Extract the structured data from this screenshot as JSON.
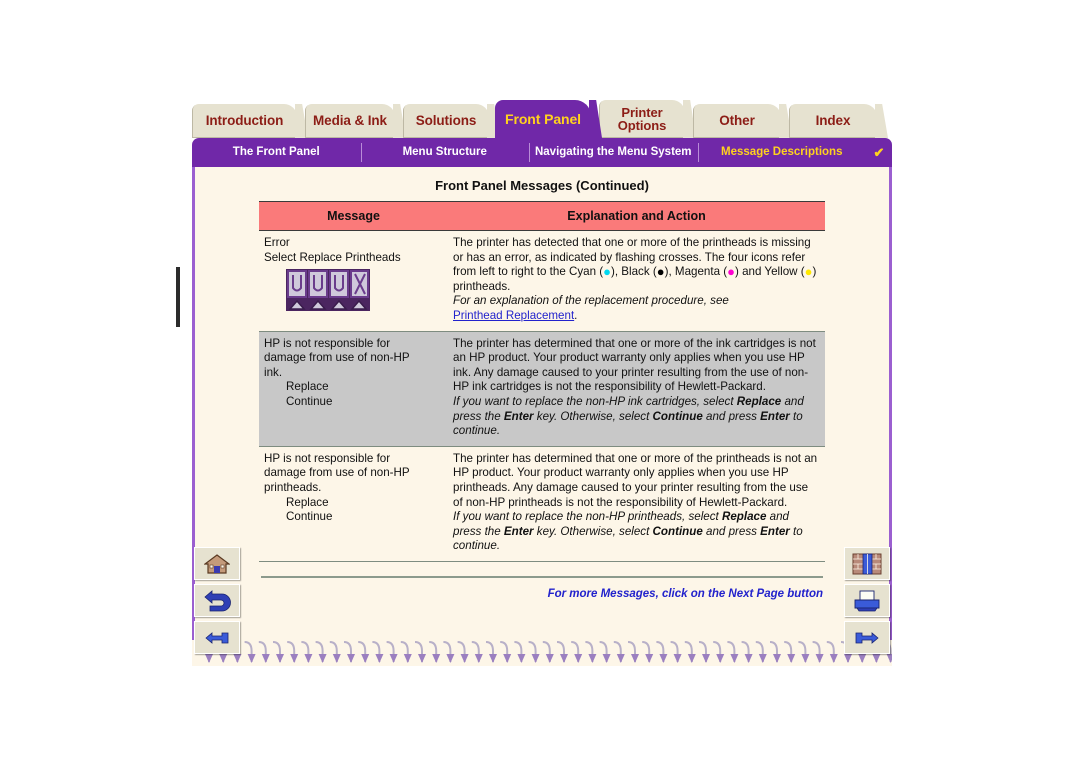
{
  "tabs": [
    {
      "label": "Introduction",
      "active": false
    },
    {
      "label": "Media & Ink",
      "active": false
    },
    {
      "label": "Solutions",
      "active": false
    },
    {
      "label": "Front Panel",
      "active": true
    },
    {
      "label": "Printer Options",
      "active": false,
      "two_line": true
    },
    {
      "label": "Other",
      "active": false
    },
    {
      "label": "Index",
      "active": false
    }
  ],
  "subnav": {
    "items": [
      {
        "label": "The Front Panel",
        "current": false
      },
      {
        "label": "Menu Structure",
        "current": false
      },
      {
        "label": "Navigating the Menu System",
        "current": false
      },
      {
        "label": "Message Descriptions",
        "current": true
      }
    ],
    "check_glyph": "✔"
  },
  "page": {
    "title": "Front Panel Messages (Continued)",
    "table": {
      "headers": [
        "Message",
        "Explanation and Action"
      ],
      "rows": [
        {
          "message_lines": [
            "Error",
            "Select Replace Printheads"
          ],
          "has_printhead_icon": true,
          "explanation": "The printer has detected that one or more of the printheads is missing or has an error, as indicated by flashing crosses. The four icons refer from left to right to the Cyan (•), Black (•), Magenta (•) and Yellow (•) printheads.",
          "italic_intro": "For an explanation of the replacement procedure, see",
          "link_text": "Printhead Replacement",
          "link_suffix": ".",
          "shaded": false
        },
        {
          "message_lines": [
            "HP is not responsible for",
            "damage from use of non-HP",
            "ink."
          ],
          "message_options": [
            "Replace",
            "Continue"
          ],
          "explanation": "The printer has determined that one or more of the ink cartridges is not an HP product. Your product warranty only applies when you use HP ink. Any damage caused to your printer resulting from the use of non-HP ink cartridges is not the responsibility of Hewlett-Packard.",
          "italic_note": "If you want to replace the non-HP ink cartridges, select Replace and press the Enter key. Otherwise, select Continue and press Enter to continue.",
          "shaded": true
        },
        {
          "message_lines": [
            "HP is not responsible for",
            "damage from use of non-HP",
            "printheads."
          ],
          "message_options": [
            "Replace",
            "Continue"
          ],
          "explanation": "The printer has determined that one or more of the printheads is not an HP product. Your product warranty only applies when you use HP printheads. Any damage caused to your printer resulting from the use of non-HP printheads is not the responsibility of Hewlett-Packard.",
          "italic_note": "If you want to replace the non-HP printheads, select Replace and press the Enter key. Otherwise, select Continue and press Enter to continue.",
          "shaded": false
        }
      ]
    },
    "footer_note": "For more Messages, click on the Next Page button"
  },
  "nav_buttons": {
    "left": [
      {
        "name": "home-button",
        "icon": "house-icon"
      },
      {
        "name": "back-button",
        "icon": "back-arrow-icon"
      },
      {
        "name": "previous-page-button",
        "icon": "pointing-hand-left-icon"
      }
    ],
    "right": [
      {
        "name": "bookshelf-button",
        "icon": "bookshelf-icon"
      },
      {
        "name": "print-button",
        "icon": "printer-icon"
      },
      {
        "name": "next-page-button",
        "icon": "pointing-hand-right-icon"
      }
    ]
  },
  "colors": {
    "purple": "#7028A8",
    "tab_beige": "#E6E2D0",
    "tab_text": "#8C1D16",
    "active_tab_text": "#FFD21E",
    "page_bg": "#FDF6E8",
    "table_header": "#FA7A7A",
    "shaded_row": "#C8C8C8",
    "link_blue": "#2222CC"
  }
}
